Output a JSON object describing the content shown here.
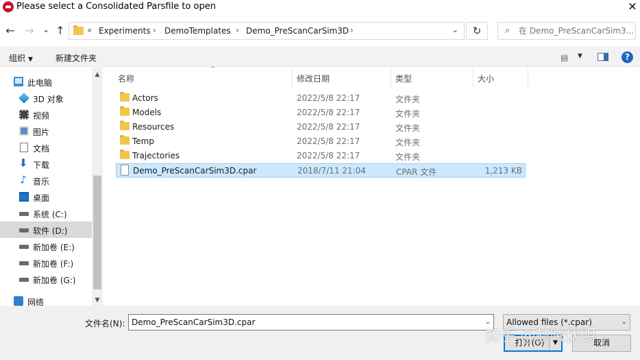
{
  "window": {
    "title": "Please select a Consolidated Parsfile to open",
    "close_glyph": "✕"
  },
  "navigation": {
    "back_glyph": "←",
    "forward_glyph": "→",
    "recent_glyph": "⌄",
    "up_glyph": "↑",
    "refresh_glyph": "↻"
  },
  "address": {
    "overflow_glyph": "«",
    "crumbs": [
      "Experiments",
      "DemoTemplates",
      "Demo_PreScanCarSim3D"
    ],
    "separator": "›",
    "dropdown_glyph": "⌄"
  },
  "search": {
    "icon_glyph": "⌕",
    "placeholder": "在 Demo_PreScanCarSim3..."
  },
  "toolbar": {
    "organize_label": "组织",
    "new_folder_label": "新建文件夹",
    "dropdown_glyph": "▼",
    "view_glyph": "▤",
    "help_glyph": "?"
  },
  "sidebar": {
    "up_glyph": "▲",
    "down_glyph": "▼",
    "items": [
      {
        "label": "此电脑",
        "icon": "computer-icon"
      },
      {
        "label": "3D 对象",
        "icon": "3d-objects-icon"
      },
      {
        "label": "视频",
        "icon": "video-icon"
      },
      {
        "label": "图片",
        "icon": "pictures-icon"
      },
      {
        "label": "文档",
        "icon": "documents-icon"
      },
      {
        "label": "下载",
        "icon": "downloads-icon",
        "glyph": "⬇"
      },
      {
        "label": "音乐",
        "icon": "music-icon",
        "glyph": "♪"
      },
      {
        "label": "桌面",
        "icon": "desktop-icon"
      },
      {
        "label": "系统 (C:)",
        "icon": "drive-icon"
      },
      {
        "label": "软件 (D:)",
        "icon": "drive-icon"
      },
      {
        "label": "新加卷 (E:)",
        "icon": "drive-icon"
      },
      {
        "label": "新加卷 (F:)",
        "icon": "drive-icon"
      },
      {
        "label": "新加卷 (G:)",
        "icon": "drive-icon"
      },
      {
        "label": "网络",
        "icon": "network-icon"
      }
    ],
    "selected_index": 9
  },
  "filelist": {
    "sort_glyph": "^",
    "columns": [
      "名称",
      "修改日期",
      "类型",
      "大小"
    ],
    "rows": [
      {
        "name": "Actors",
        "date": "2022/5/8 22:17",
        "type": "文件夹",
        "size": "",
        "kind": "folder"
      },
      {
        "name": "Models",
        "date": "2022/5/8 22:17",
        "type": "文件夹",
        "size": "",
        "kind": "folder"
      },
      {
        "name": "Resources",
        "date": "2022/5/8 22:17",
        "type": "文件夹",
        "size": "",
        "kind": "folder"
      },
      {
        "name": "Temp",
        "date": "2022/5/8 22:17",
        "type": "文件夹",
        "size": "",
        "kind": "folder"
      },
      {
        "name": "Trajectories",
        "date": "2022/5/8 22:17",
        "type": "文件夹",
        "size": "",
        "kind": "folder"
      },
      {
        "name": "Demo_PreScanCarSim3D.cpar",
        "date": "2018/7/11 21:04",
        "type": "CPAR 文件",
        "size": "1,213 KB",
        "kind": "file"
      }
    ],
    "selected_index": 5
  },
  "footer": {
    "filename_label": "文件名(N):",
    "filename_value": "Demo_PreScanCarSim3D.cpar",
    "filter_value": "Allowed files (*.cpar)",
    "dropdown_glyph": "⌄",
    "open_label": "打开(O)",
    "open_split_glyph": "▼",
    "cancel_label": "取消",
    "watermark": "知乎 @赫曦伏明"
  },
  "colors": {
    "selection_bg": "#cce8ff",
    "selection_border": "#99d1ff",
    "folder": "#f2c54b",
    "accent": "#0078d7"
  }
}
